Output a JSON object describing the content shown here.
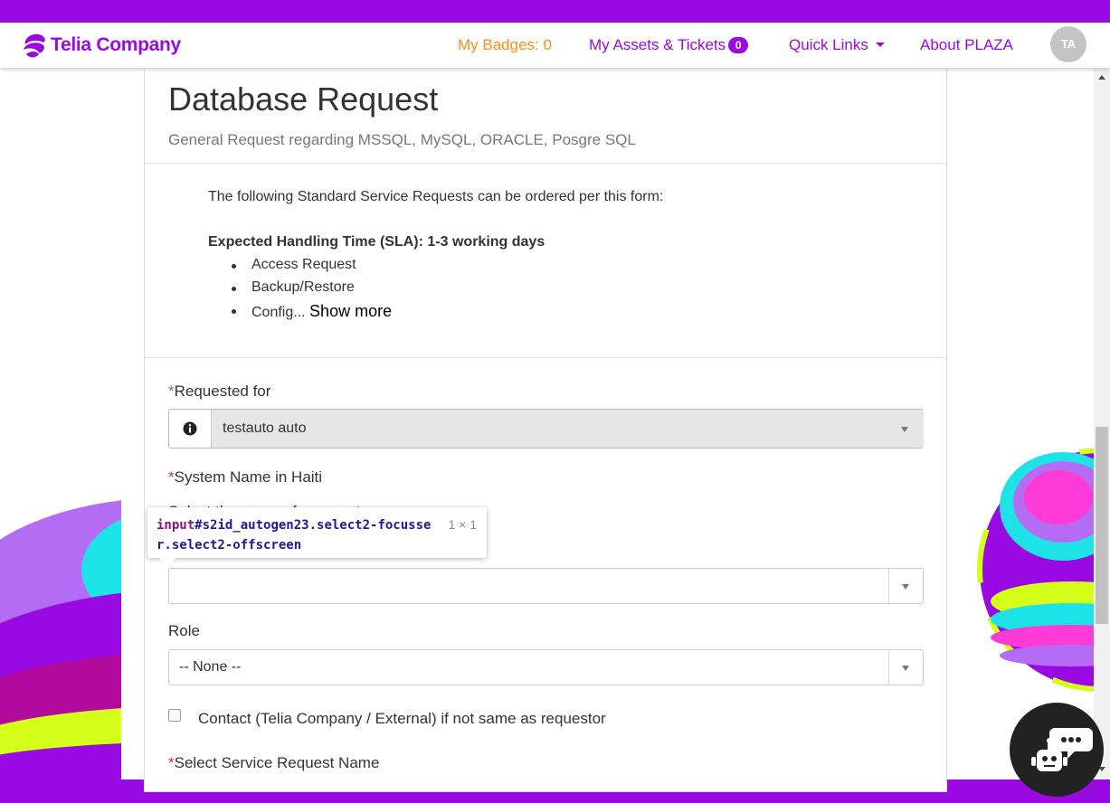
{
  "nav": {
    "logo_text": "Telia Company",
    "badges_label": "My Badges: 0",
    "assets_label": "My Assets & Tickets",
    "assets_count": "0",
    "quick_links_label": "Quick Links",
    "about_label": "About PLAZA",
    "avatar_initials": "TA"
  },
  "header": {
    "title": "Database Request",
    "subtitle": "General Request regarding MSSQL, MySQL, ORACLE, Posgre SQL"
  },
  "description": {
    "intro": "The following Standard Service Requests can be ordered per this form:",
    "sla": "Expected Handling Time (SLA): 1-3 working days",
    "items": [
      "Access Request",
      "Backup/Restore",
      "Config..."
    ],
    "show_more": "Show more"
  },
  "form": {
    "requested_for": {
      "label": "Requested for",
      "value": "testauto auto"
    },
    "system_name": {
      "label": "System Name in Haiti",
      "hint": "Select the name of a ...ment"
    },
    "role": {
      "label": "Role",
      "value": "-- None --"
    },
    "contact_checkbox_label": "Contact (Telia Company / External) if not same as requestor",
    "service_request": {
      "label": "Select Service Request Name"
    }
  },
  "tooltip": {
    "tag": "input",
    "selector": "#s2id_autogen23.select2-focusser.select2-offscreen",
    "size": "1 × 1"
  },
  "colors": {
    "brand": "#990ae3",
    "badge_orange": "#ff8c1a",
    "required": "#c0392b"
  },
  "icons": {
    "info": "info-icon",
    "chat": "chatbot-icon",
    "dropdown": "caret-down-icon"
  }
}
